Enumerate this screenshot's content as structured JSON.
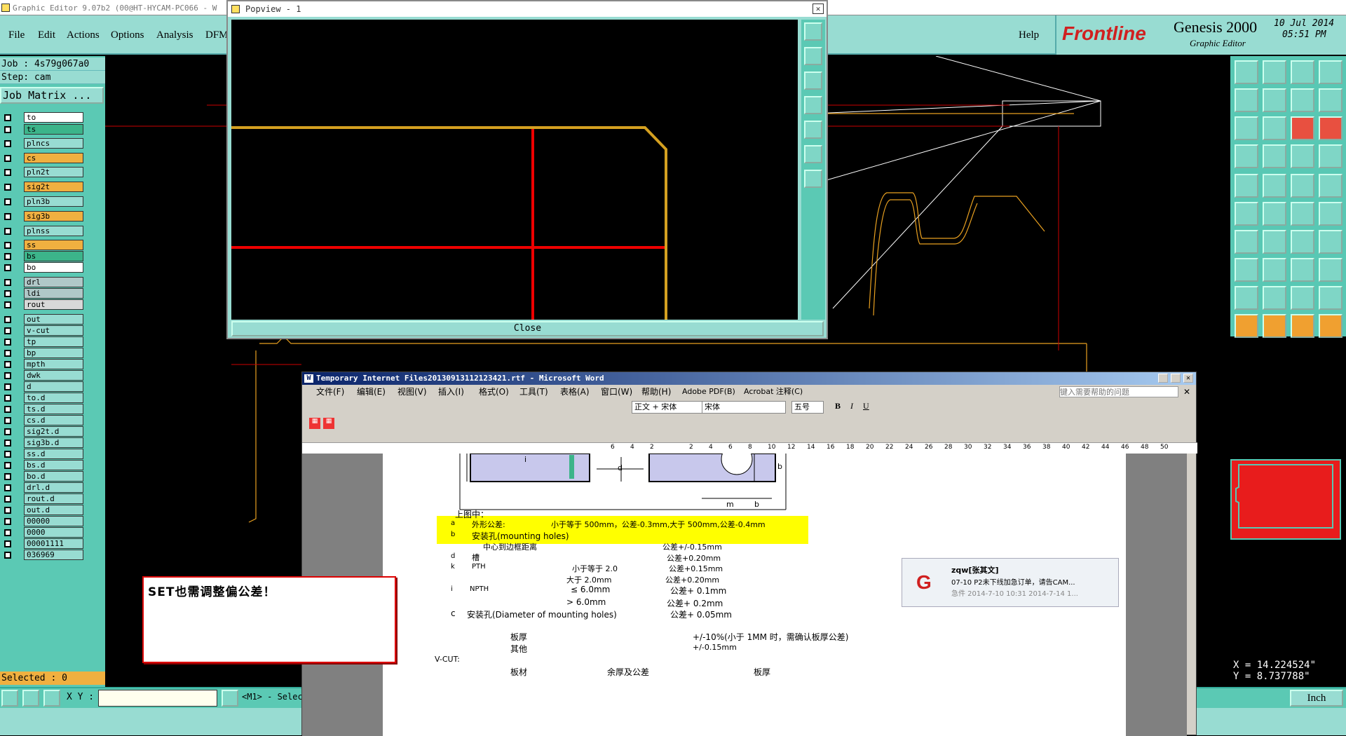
{
  "genesis": {
    "title": "Graphic Editor 9.07b2 (00@HT-HYCAM-PC066 - W",
    "menu": [
      "File",
      "Edit",
      "Actions",
      "Options",
      "Analysis",
      "DFM"
    ],
    "help": "Help",
    "brand_logo": "Frontline",
    "brand_product": "Genesis 2000",
    "brand_sub": "Graphic Editor",
    "date": "10 Jul 2014",
    "time": "05:51 PM",
    "job": "Job : 4s79g067a0",
    "step": "Step: cam",
    "job_matrix": "Job Matrix ...",
    "layers": [
      {
        "name": "to",
        "color": "#ffffff"
      },
      {
        "name": "ts",
        "color": "#3cb48a"
      },
      {
        "name": "plncs",
        "color": "#98dcd2"
      },
      {
        "name": "cs",
        "color": "#f0b040"
      },
      {
        "name": "pln2t",
        "color": "#98dcd2"
      },
      {
        "name": "sig2t",
        "color": "#f0b040"
      },
      {
        "name": "pln3b",
        "color": "#98dcd2"
      },
      {
        "name": "sig3b",
        "color": "#f0b040"
      },
      {
        "name": "plnss",
        "color": "#98dcd2"
      },
      {
        "name": "ss",
        "color": "#f0b040"
      },
      {
        "name": "bs",
        "color": "#3cb48a"
      },
      {
        "name": "bo",
        "color": "#ffffff"
      },
      {
        "name": "drl",
        "color": "#b0c8c8"
      },
      {
        "name": "ldi",
        "color": "#b0c8c8"
      },
      {
        "name": "rout",
        "color": "#d8d8d8"
      },
      {
        "name": "out",
        "color": "#98dcd2"
      },
      {
        "name": "v-cut",
        "color": "#98dcd2"
      },
      {
        "name": "tp",
        "color": "#98dcd2"
      },
      {
        "name": "bp",
        "color": "#98dcd2"
      },
      {
        "name": "mpth",
        "color": "#98dcd2"
      },
      {
        "name": "dwk",
        "color": "#98dcd2"
      },
      {
        "name": "d",
        "color": "#98dcd2"
      },
      {
        "name": "to.d",
        "color": "#98dcd2"
      },
      {
        "name": "ts.d",
        "color": "#98dcd2"
      },
      {
        "name": "cs.d",
        "color": "#98dcd2"
      },
      {
        "name": "sig2t.d",
        "color": "#98dcd2"
      },
      {
        "name": "sig3b.d",
        "color": "#98dcd2"
      },
      {
        "name": "ss.d",
        "color": "#98dcd2"
      },
      {
        "name": "bs.d",
        "color": "#98dcd2"
      },
      {
        "name": "bo.d",
        "color": "#98dcd2"
      },
      {
        "name": "drl.d",
        "color": "#98dcd2"
      },
      {
        "name": "rout.d",
        "color": "#98dcd2"
      },
      {
        "name": "out.d",
        "color": "#98dcd2"
      },
      {
        "name": "00000",
        "color": "#98dcd2"
      },
      {
        "name": "0000",
        "color": "#98dcd2"
      },
      {
        "name": "00001111",
        "color": "#98dcd2"
      },
      {
        "name": "036969",
        "color": "#98dcd2"
      }
    ],
    "selected": "Selected : 0",
    "xy_label": "X Y :",
    "mouse_hint": "<M1> - Selec",
    "coord_x": "X = 14.224524\"",
    "coord_y": "Y = 8.737788\"",
    "units": "Inch"
  },
  "popview": {
    "title": "Popview - 1",
    "close": "Close"
  },
  "word": {
    "title": "Temporary Internet Files20130913112123421.rtf - Microsoft Word",
    "menu": [
      "文件(F)",
      "编辑(E)",
      "视图(V)",
      "插入(I)",
      "格式(O)",
      "工具(T)",
      "表格(A)",
      "窗口(W)",
      "帮助(H)",
      "Adobe PDF(B)",
      "Acrobat 注释(C)"
    ],
    "help_placeholder": "键入需要帮助的问题",
    "style": "正文 + 宋体",
    "font": "宋体",
    "size": "五号",
    "ruler_ticks": [
      "6",
      "4",
      "2",
      "",
      "2",
      "4",
      "6",
      "8",
      "10",
      "12",
      "14",
      "16",
      "18",
      "20",
      "22",
      "24",
      "26",
      "28",
      "30",
      "32",
      "34",
      "36",
      "38",
      "40",
      "42",
      "44",
      "46",
      "48",
      "50"
    ],
    "doc": {
      "fig_d": "d",
      "fig_i": "i",
      "fig_b": "b",
      "fig_m": "m",
      "fig_b2": "b",
      "heading": "上图中：",
      "row_a_k": "a",
      "row_a_l": "外形公差:",
      "row_a_v": "小于等于 500mm，公差-0.3mm,大于 500mm,公差-0.4mm",
      "row_b_k": "b",
      "row_b_l": "安装孔(mounting holes)",
      "row_c2_l": "中心到边框距离",
      "row_c2_v": "公差+/-0.15mm",
      "row_d_k": "d",
      "row_d_l": "槽",
      "row_d_v": "公差+0.20mm",
      "row_k_k": "k",
      "row_k_l": "PTH",
      "row_k_m": "小于等于 2.0",
      "row_k_v": "公差+0.15mm",
      "row_k2_m": "大于 2.0mm",
      "row_k2_v": "公差+0.20mm",
      "row_i_k": "i",
      "row_i_l": "NPTH",
      "row_i_m": "≤ 6.0mm",
      "row_i_v": "公差+ 0.1mm",
      "row_i2_m": "> 6.0mm",
      "row_i2_v": "公差+ 0.2mm",
      "row_c_k": "c",
      "row_c_l": "安装孔(Diameter of mounting holes)",
      "row_c_v": "公差+ 0.05mm",
      "thick_l": "板厚",
      "thick_v": "+/-10%(小于 1MM 时，需确认板厚公差)",
      "other_l": "其他",
      "other_v": "+/-0.15mm",
      "vcut": "V-CUT:",
      "col1": "板材",
      "col2": "余厚及公差",
      "col3": "板厚"
    }
  },
  "notification": {
    "sender": "zqw[张其文]",
    "line": "07-10  P2未下线加急订单，请告CAM...",
    "meta": "急件 2014-7-10 10:31 2014-7-14 1..."
  },
  "callout": {
    "text": "SET也需调整偏公差！"
  }
}
